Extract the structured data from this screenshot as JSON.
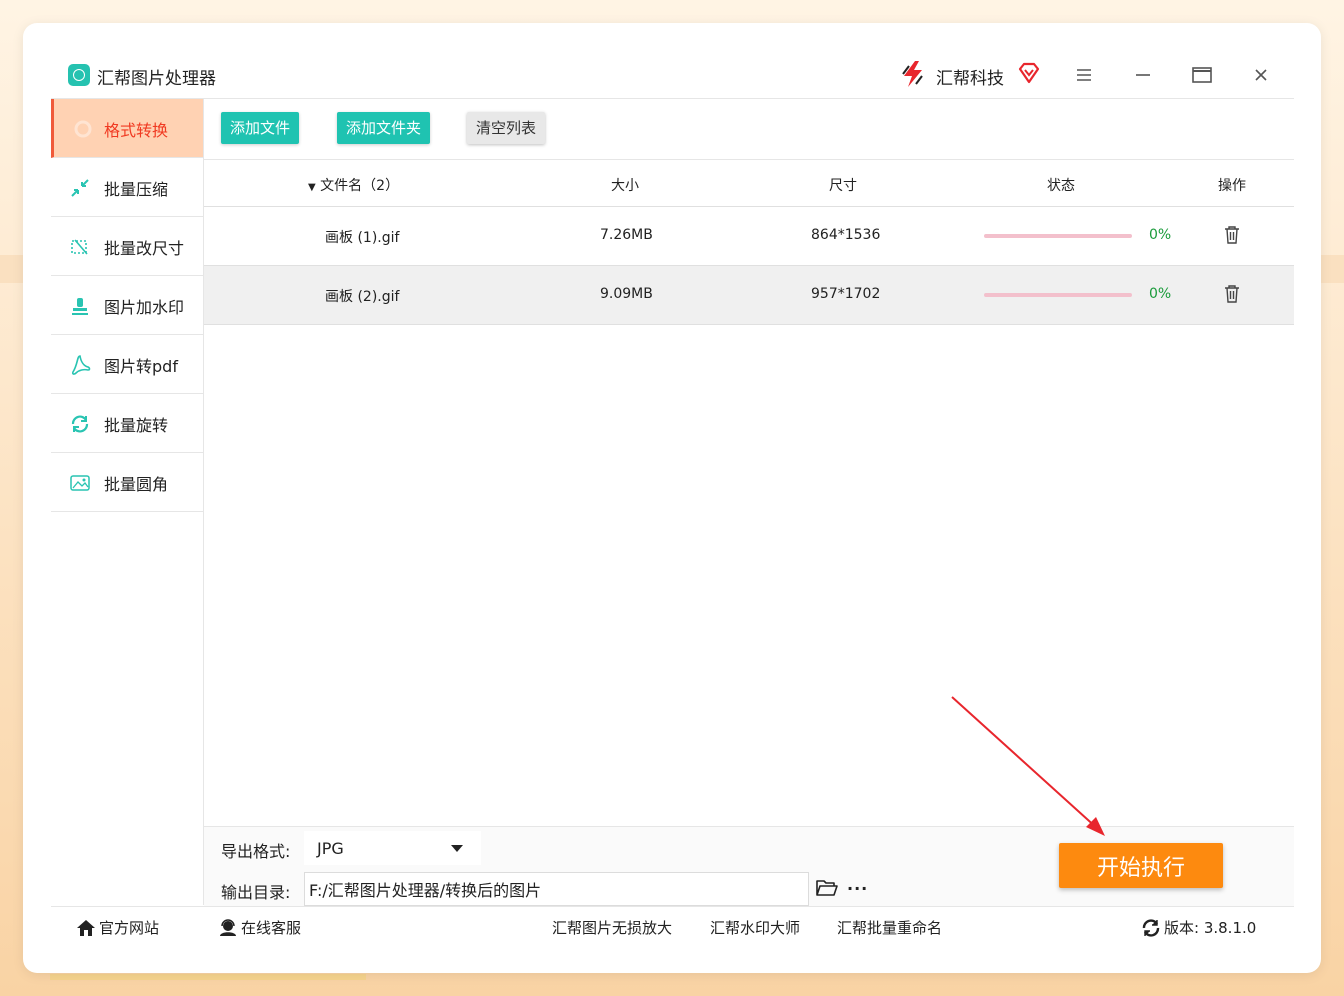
{
  "app": {
    "title": "汇帮图片处理器",
    "brand": "汇帮科技"
  },
  "window_controls": {
    "menu": "≡",
    "minimize": "−",
    "maximize": "▭",
    "close": "✕"
  },
  "sidebar": {
    "items": [
      {
        "label": "格式转换",
        "icon": "convert-icon",
        "active": true
      },
      {
        "label": "批量压缩",
        "icon": "compress-icon"
      },
      {
        "label": "批量改尺寸",
        "icon": "resize-icon"
      },
      {
        "label": "图片加水印",
        "icon": "watermark-icon"
      },
      {
        "label": "图片转pdf",
        "icon": "pdf-icon"
      },
      {
        "label": "批量旋转",
        "icon": "rotate-icon"
      },
      {
        "label": "批量圆角",
        "icon": "round-corner-icon"
      }
    ]
  },
  "toolbar": {
    "add_file": "添加文件",
    "add_folder": "添加文件夹",
    "clear_list": "清空列表"
  },
  "table": {
    "headers": {
      "name": "文件名（2）",
      "size": "大小",
      "dimension": "尺寸",
      "status": "状态",
      "action": "操作"
    },
    "rows": [
      {
        "name": "画板 (1).gif",
        "size": "7.26MB",
        "dimension": "864*1536",
        "progress": 0,
        "pct": "0%"
      },
      {
        "name": "画板 (2).gif",
        "size": "9.09MB",
        "dimension": "957*1702",
        "progress": 0,
        "pct": "0%"
      }
    ]
  },
  "export": {
    "format_label": "导出格式:",
    "format_value": "JPG",
    "dir_label": "输出目录:",
    "dir_value": "F:/汇帮图片处理器/转换后的图片",
    "more": "···",
    "start": "开始执行"
  },
  "footer": {
    "website": "官方网站",
    "support": "在线客服",
    "link1": "汇帮图片无损放大",
    "link2": "汇帮水印大师",
    "link3": "汇帮批量重命名",
    "version": "版本: 3.8.1.0"
  },
  "colors": {
    "teal": "#1fc3b1",
    "orange": "#fd8a0f",
    "active_bg": "#ffd2b3",
    "active_text": "#f03a22",
    "green": "#1a9b3b"
  }
}
